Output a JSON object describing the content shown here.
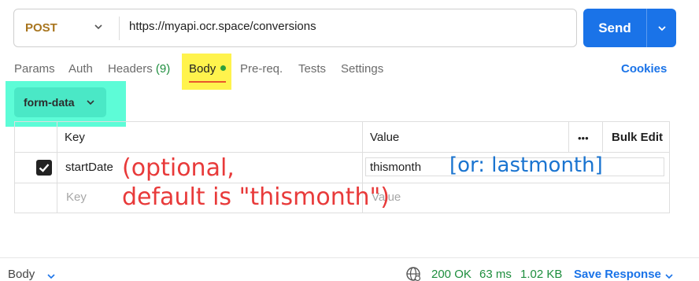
{
  "request": {
    "method": "POST",
    "url": "https://myapi.ocr.space/conversions",
    "send_label": "Send"
  },
  "tabs": {
    "params": "Params",
    "auth": "Auth",
    "headers": "Headers",
    "headers_count": "(9)",
    "body": "Body",
    "prereq": "Pre-req.",
    "tests": "Tests",
    "settings": "Settings",
    "cookies": "Cookies"
  },
  "body_mode": "form-data",
  "table": {
    "headers": {
      "key": "Key",
      "value": "Value",
      "more": "•••",
      "bulk_edit": "Bulk Edit"
    },
    "rows": [
      {
        "checked": true,
        "key": "startDate",
        "value": "thismonth"
      }
    ],
    "placeholder": {
      "key": "Key",
      "value": "Value"
    }
  },
  "annotations": {
    "optional_line1": "(optional,",
    "optional_line2": "default is \"thismonth\")",
    "alternative": "[or: lastmonth]"
  },
  "footer": {
    "body_label": "Body",
    "status": "200 OK",
    "time": "63 ms",
    "size": "1.02 KB",
    "save_response": "Save Response"
  },
  "colors": {
    "send_button": "#1a73e8",
    "body_highlight": "#fff34d",
    "form_data_highlight": "#5dfcd7",
    "annotation_red": "#e83a3a",
    "annotation_blue": "#1a74d0",
    "status_green": "#1e8e3e"
  }
}
